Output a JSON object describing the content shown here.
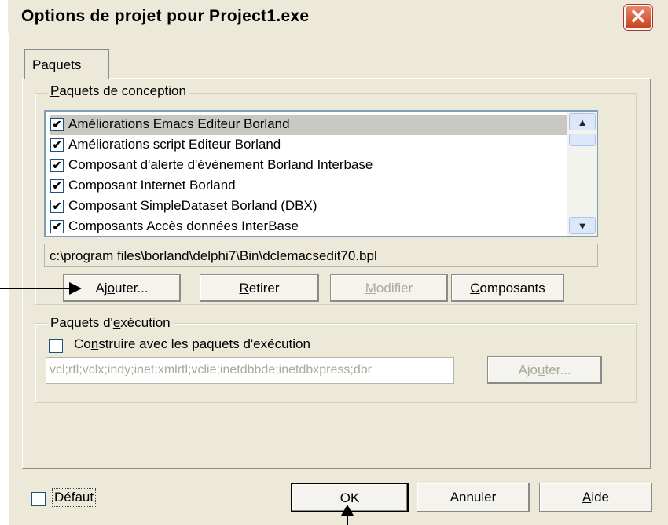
{
  "dialog": {
    "title": "Options de projet pour Project1.exe",
    "close_symbol": "✕"
  },
  "tabs": [
    {
      "label": "Paquets"
    }
  ],
  "design_group": {
    "legend_prefix": "",
    "legend_underlined": "P",
    "legend_suffix": "aquets de conception",
    "items": [
      {
        "label": "Améliorations Emacs Editeur Borland",
        "checked": true,
        "selected": true
      },
      {
        "label": "Améliorations script Editeur Borland",
        "checked": true,
        "selected": false
      },
      {
        "label": "Composant d'alerte d'événement Borland Interbase",
        "checked": true,
        "selected": false
      },
      {
        "label": "Composant Internet Borland",
        "checked": true,
        "selected": false
      },
      {
        "label": "Composant SimpleDataset Borland (DBX)",
        "checked": true,
        "selected": false
      },
      {
        "label": "Composants Accès données InterBase",
        "checked": true,
        "selected": false
      }
    ],
    "check_glyph": "✔",
    "scroll_up": "▲",
    "scroll_down": "▼",
    "path": "c:\\program files\\borland\\delphi7\\Bin\\dclemacsedit70.bpl",
    "buttons": {
      "add": {
        "pre": "Aj",
        "u": "o",
        "post": "uter..."
      },
      "remove": {
        "pre": "",
        "u": "R",
        "post": "etirer"
      },
      "modify": {
        "pre": "",
        "u": "M",
        "post": "odifier"
      },
      "components": {
        "pre": "",
        "u": "C",
        "post": "omposants"
      }
    }
  },
  "runtime_group": {
    "legend_prefix": "Paquets d'",
    "legend_underlined": "e",
    "legend_suffix": "xécution",
    "build_checkbox": {
      "pre": "Co",
      "u": "n",
      "post": "struire avec les paquets d'exécution",
      "checked": false
    },
    "packages_value": "vcl;rtl;vclx;indy;inet;xmlrtl;vclie;inetdbbde;inetdbxpress;dbr",
    "add_button": {
      "pre": "Ajo",
      "u": "u",
      "post": "ter..."
    }
  },
  "footer": {
    "default_label": "Défaut",
    "default_checked": false,
    "ok_label": "OK",
    "cancel_label": "Annuler",
    "help": {
      "pre": "",
      "u": "A",
      "post": "ide"
    }
  }
}
